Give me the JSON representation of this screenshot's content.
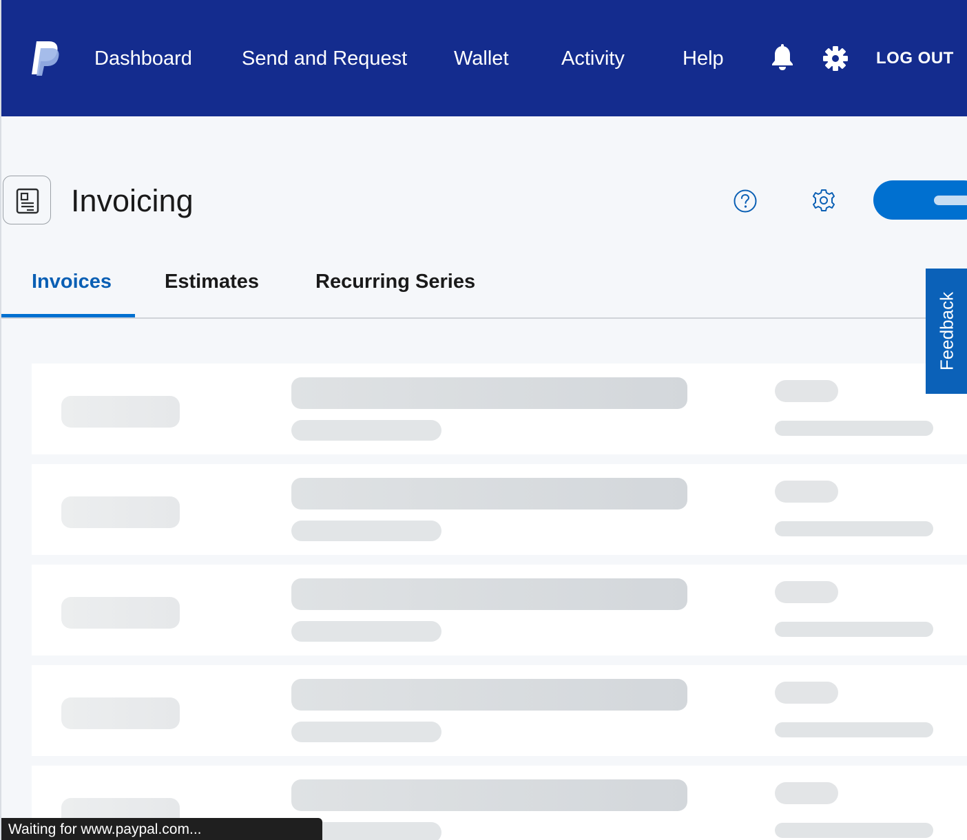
{
  "nav": {
    "items": [
      {
        "label": "Dashboard"
      },
      {
        "label": "Send and Request"
      },
      {
        "label": "Wallet"
      },
      {
        "label": "Activity"
      },
      {
        "label": "Help"
      }
    ],
    "notifications_icon": "bell-icon",
    "settings_icon": "gear-icon",
    "logout_label": "LOG OUT",
    "background_color": "#142c8e"
  },
  "header": {
    "app_icon": "invoice-document-icon",
    "title": "Invoicing",
    "help_icon": "help-circle-icon",
    "settings_icon": "settings-gear-outline-icon",
    "primary_button_color": "#0070d0"
  },
  "tabs": [
    {
      "label": "Invoices",
      "active": true
    },
    {
      "label": "Estimates",
      "active": false
    },
    {
      "label": "Recurring Series",
      "active": false
    }
  ],
  "feedback": {
    "label": "Feedback"
  },
  "list": {
    "state": "loading",
    "placeholder_rows": 5
  },
  "status_bar": {
    "text": "Waiting for www.paypal.com..."
  }
}
